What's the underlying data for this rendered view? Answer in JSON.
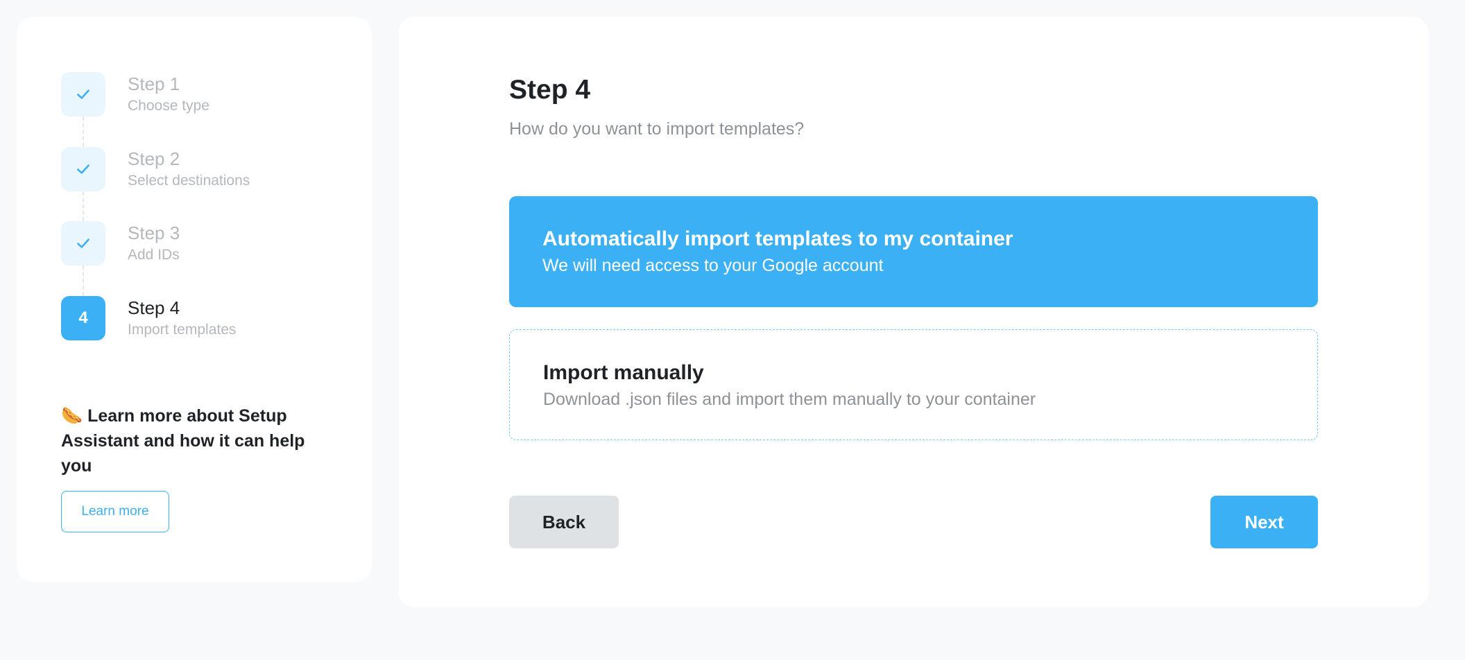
{
  "sidebar": {
    "steps": [
      {
        "title": "Step 1",
        "subtitle": "Choose type",
        "status": "completed",
        "icon": "check-icon"
      },
      {
        "title": "Step 2",
        "subtitle": "Select destinations",
        "status": "completed",
        "icon": "check-icon"
      },
      {
        "title": "Step 3",
        "subtitle": "Add IDs",
        "status": "completed",
        "icon": "check-icon"
      },
      {
        "title": "Step 4",
        "subtitle": "Import templates",
        "status": "active",
        "number": "4"
      }
    ],
    "learn": {
      "emoji": "🌭",
      "heading": "Learn more about Setup Assistant and how it can help you",
      "button_label": "Learn more"
    }
  },
  "main": {
    "title": "Step 4",
    "subtitle": "How do you want to import templates?",
    "options": [
      {
        "title": "Automatically import templates to my container",
        "subtitle": "We will need access to your Google account",
        "selected": true
      },
      {
        "title": "Import manually",
        "subtitle": "Download .json files and import them manually to your container",
        "selected": false
      }
    ],
    "back_label": "Back",
    "next_label": "Next"
  },
  "colors": {
    "accent": "#3bb0f4",
    "completed_badge_bg": "#eaf6fd",
    "muted_text": "#b4b8bd",
    "page_bg": "#f8f9fb"
  }
}
